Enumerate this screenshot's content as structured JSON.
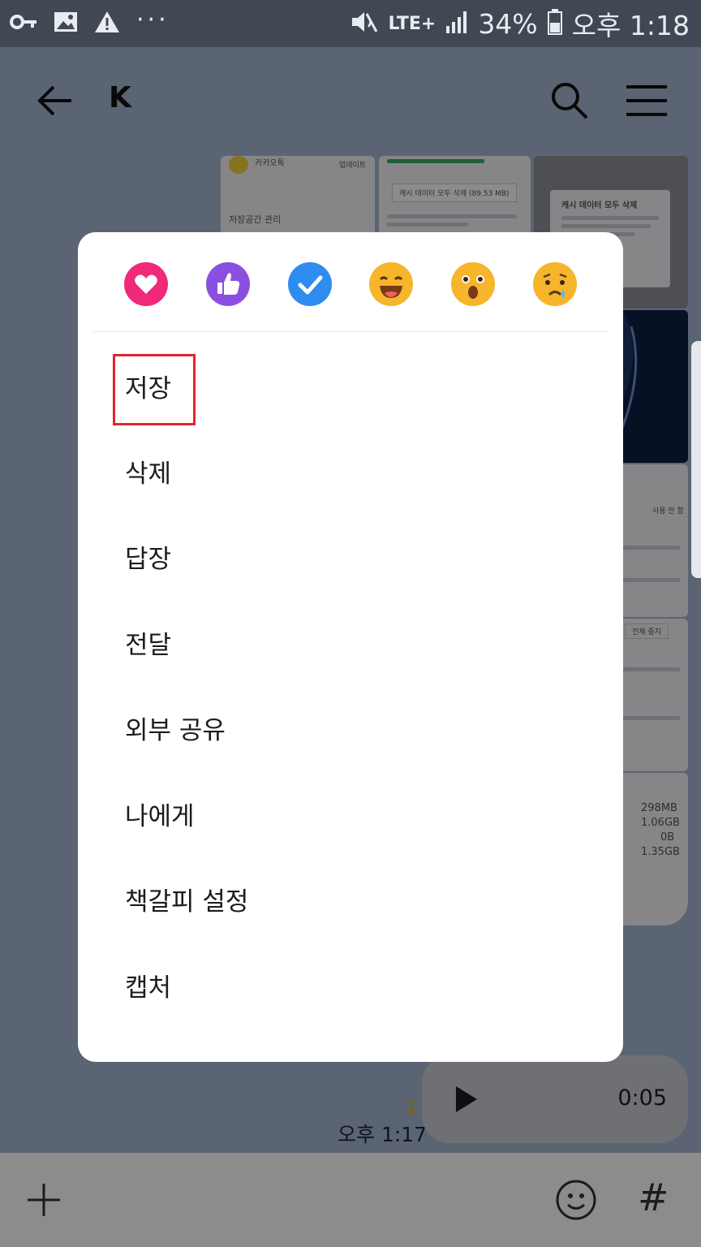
{
  "status_bar": {
    "network": "LTE+",
    "battery": "34%",
    "time": "오후 1:18",
    "icons": [
      "key-icon",
      "image-icon",
      "warning-icon",
      "more-dots-icon",
      "mute-icon",
      "signal-icon",
      "battery-icon"
    ]
  },
  "header": {
    "title": "K"
  },
  "chat": {
    "time": "오후 1:17",
    "unread": "1",
    "voice_message": {
      "duration": "0:05"
    },
    "background_texts": [
      "카카오톡",
      "업데이트",
      "저장공간 관리",
      "캐시 데이터 모두 삭제 (89.53 MB)",
      "캐시 데이터 모두 삭제",
      "전체 중지",
      "298MB",
      "1.06GB",
      "0B",
      "1.35GB",
      "사용 안 함"
    ]
  },
  "context_menu": {
    "reactions": [
      {
        "name": "heart",
        "color": "#f0297a"
      },
      {
        "name": "thumbs-up",
        "color": "#8a4fe0"
      },
      {
        "name": "check",
        "color": "#2f8cf0"
      },
      {
        "name": "laugh",
        "color": "#f6b52b"
      },
      {
        "name": "surprised",
        "color": "#f6b52b"
      },
      {
        "name": "sad",
        "color": "#f6b52b"
      }
    ],
    "items": [
      {
        "label": "저장"
      },
      {
        "label": "삭제"
      },
      {
        "label": "답장"
      },
      {
        "label": "전달"
      },
      {
        "label": "외부 공유"
      },
      {
        "label": "나에게"
      },
      {
        "label": "책갈피 설정"
      },
      {
        "label": "캡처"
      }
    ],
    "highlight_color": "#e1262c"
  },
  "input_bar": {
    "icons": [
      "plus-icon",
      "emoji-icon",
      "hash-icon"
    ],
    "hash_label": "#"
  }
}
